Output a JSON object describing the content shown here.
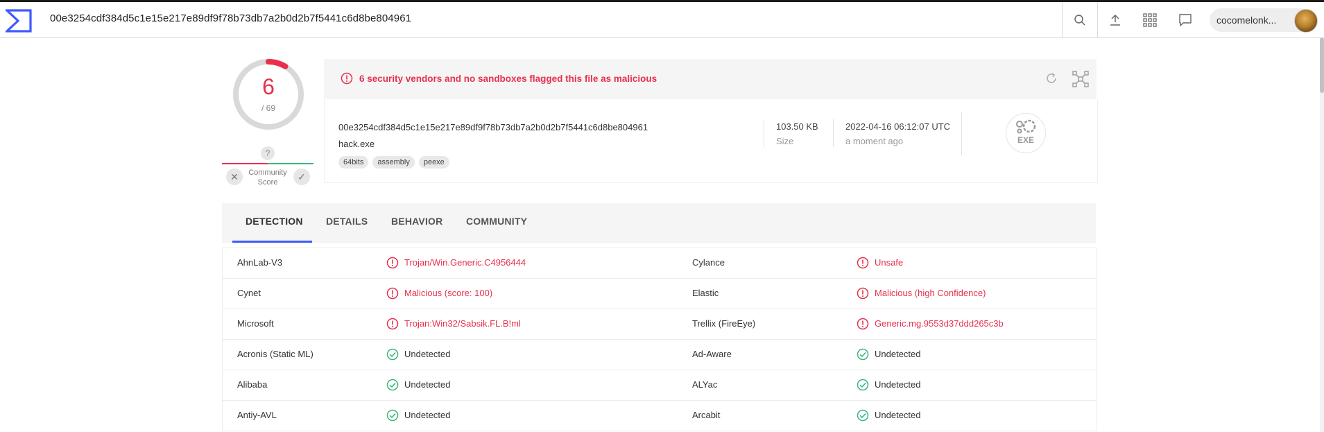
{
  "topbar": {
    "search_value": "00e3254cdf384d5c1e15e217e89df9f78b73db7a2b0d2b7f5441c6d8be804961",
    "icons": [
      "search-icon",
      "upload-icon",
      "apps-grid-icon",
      "chat-icon"
    ],
    "username": "cocomelonk..."
  },
  "score": {
    "detections": "6",
    "total": "/ 69",
    "community_unknown": "?",
    "community_label_1": "Community",
    "community_label_2": "Score",
    "colors": {
      "bad": "#e8304d",
      "good": "#3bb77e"
    }
  },
  "header": {
    "alert": "6 security vendors and no sandboxes flagged this file as malicious",
    "hash": "00e3254cdf384d5c1e15e217e89df9f78b73db7a2b0d2b7f5441c6d8be804961",
    "filename": "hack.exe",
    "tags": [
      "64bits",
      "assembly",
      "peexe"
    ],
    "size_value": "103.50 KB",
    "size_label": "Size",
    "date_value": "2022-04-16 06:12:07 UTC",
    "date_label": "a moment ago",
    "filetype": "EXE"
  },
  "tabs": [
    {
      "label": "DETECTION",
      "active": true
    },
    {
      "label": "DETAILS",
      "active": false
    },
    {
      "label": "BEHAVIOR",
      "active": false
    },
    {
      "label": "COMMUNITY",
      "active": false
    }
  ],
  "detections": [
    {
      "left": {
        "vendor": "AhnLab-V3",
        "result": "Trojan/Win.Generic.C4956444",
        "malicious": true
      },
      "right": {
        "vendor": "Cylance",
        "result": "Unsafe",
        "malicious": true
      }
    },
    {
      "left": {
        "vendor": "Cynet",
        "result": "Malicious (score: 100)",
        "malicious": true
      },
      "right": {
        "vendor": "Elastic",
        "result": "Malicious (high Confidence)",
        "malicious": true
      }
    },
    {
      "left": {
        "vendor": "Microsoft",
        "result": "Trojan:Win32/Sabsik.FL.B!ml",
        "malicious": true
      },
      "right": {
        "vendor": "Trellix (FireEye)",
        "result": "Generic.mg.9553d37ddd265c3b",
        "malicious": true
      }
    },
    {
      "left": {
        "vendor": "Acronis (Static ML)",
        "result": "Undetected",
        "malicious": false
      },
      "right": {
        "vendor": "Ad-Aware",
        "result": "Undetected",
        "malicious": false
      }
    },
    {
      "left": {
        "vendor": "Alibaba",
        "result": "Undetected",
        "malicious": false
      },
      "right": {
        "vendor": "ALYac",
        "result": "Undetected",
        "malicious": false
      }
    },
    {
      "left": {
        "vendor": "Antiy-AVL",
        "result": "Undetected",
        "malicious": false
      },
      "right": {
        "vendor": "Arcabit",
        "result": "Undetected",
        "malicious": false
      }
    }
  ]
}
